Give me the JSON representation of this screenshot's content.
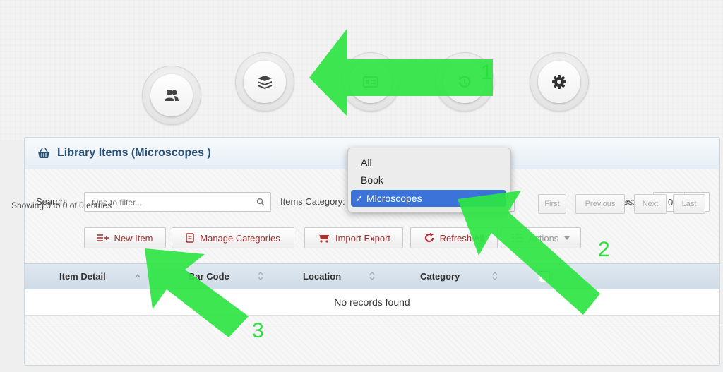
{
  "nav": {
    "items": [
      {
        "icon": "users-icon"
      },
      {
        "icon": "layers-icon"
      },
      {
        "icon": "id-card-icon"
      },
      {
        "icon": "history-icon"
      },
      {
        "icon": "gear-icon"
      }
    ]
  },
  "panel": {
    "title": "Library Items (Microscopes )",
    "search_label": "Search:",
    "search_placeholder": "type to filter...",
    "category_label": "Items Category:",
    "category_selected": "Microscopes",
    "entries_label": "Show entries:",
    "entries_value": "10"
  },
  "buttons": {
    "new_item": "New Item",
    "manage_categories": "Manage Categories",
    "import_export": "Import Export",
    "refresh_all": "Refresh All",
    "actions": "Actions"
  },
  "table": {
    "columns": [
      "Item Detail",
      "Bar Code",
      "Location",
      "Category"
    ],
    "empty_message": "No records found"
  },
  "footer": {
    "info": "Showing 0 to 0 of 0 entries",
    "pagination": [
      "First",
      "Previous",
      "Next",
      "Last"
    ]
  },
  "dropdown": {
    "options": [
      "All",
      "Book",
      "Microscopes"
    ],
    "checkmark": "✓"
  },
  "annotations": {
    "labels": [
      "1",
      "2",
      "3"
    ],
    "color": "#2ee543"
  }
}
